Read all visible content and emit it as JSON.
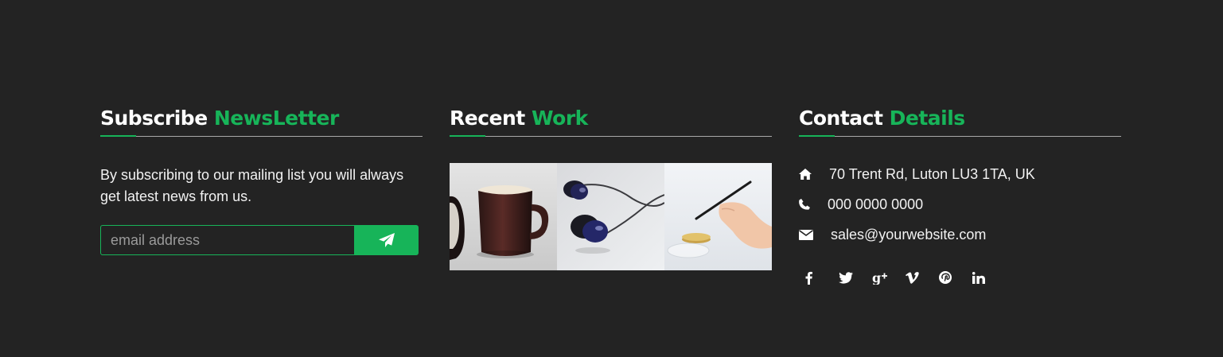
{
  "newsletter": {
    "title_main": "Subscribe",
    "title_accent": "NewsLetter",
    "description": "By subscribing to our mailing list you will always get latest news from us.",
    "email_placeholder": "email address",
    "submit_icon": "paper-plane-icon"
  },
  "recent_work": {
    "title_main": "Recent",
    "title_accent": "Work",
    "images": [
      "coffee-mug-photo",
      "earphones-photo",
      "hand-with-pen-photo"
    ]
  },
  "contact": {
    "title_main": "Contact",
    "title_accent": "Details",
    "address": "70 Trent Rd, Luton LU3 1TA, UK",
    "phone": "000 0000 0000",
    "email": "sales@yourwebsite.com",
    "icons": [
      "home-icon",
      "phone-icon",
      "envelope-icon"
    ]
  },
  "social": [
    "facebook-icon",
    "twitter-icon",
    "google-plus-icon",
    "vimeo-icon",
    "pinterest-icon",
    "linkedin-icon"
  ],
  "colors": {
    "background": "#232323",
    "accent": "#17b459",
    "text": "#ffffff"
  }
}
